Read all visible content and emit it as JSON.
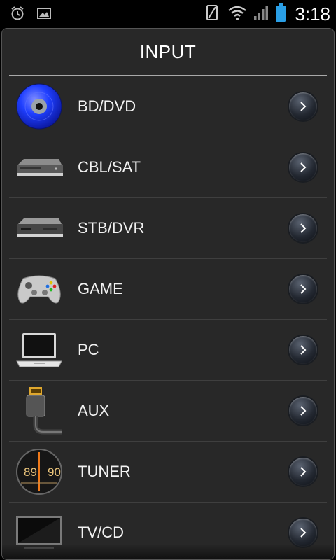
{
  "status_bar": {
    "time": "3:18",
    "icons": [
      "alarm-icon",
      "image-icon",
      "rotation-icon",
      "wifi-icon",
      "signal-icon",
      "battery-icon"
    ]
  },
  "dialog": {
    "title": "INPUT",
    "items": [
      {
        "label": "BD/DVD",
        "icon": "disc-icon"
      },
      {
        "label": "CBL/SAT",
        "icon": "cable-box-icon"
      },
      {
        "label": "STB/DVR",
        "icon": "set-top-box-icon"
      },
      {
        "label": "GAME",
        "icon": "gamepad-icon"
      },
      {
        "label": "PC",
        "icon": "laptop-icon"
      },
      {
        "label": "AUX",
        "icon": "hdmi-cable-icon"
      },
      {
        "label": "TUNER",
        "icon": "radio-dial-icon"
      },
      {
        "label": "TV/CD",
        "icon": "tv-icon"
      }
    ]
  },
  "colors": {
    "panel": "#282828",
    "divider": "#3f3f3f",
    "battery": "#2a9fe6",
    "disc": "#1f3fff"
  }
}
